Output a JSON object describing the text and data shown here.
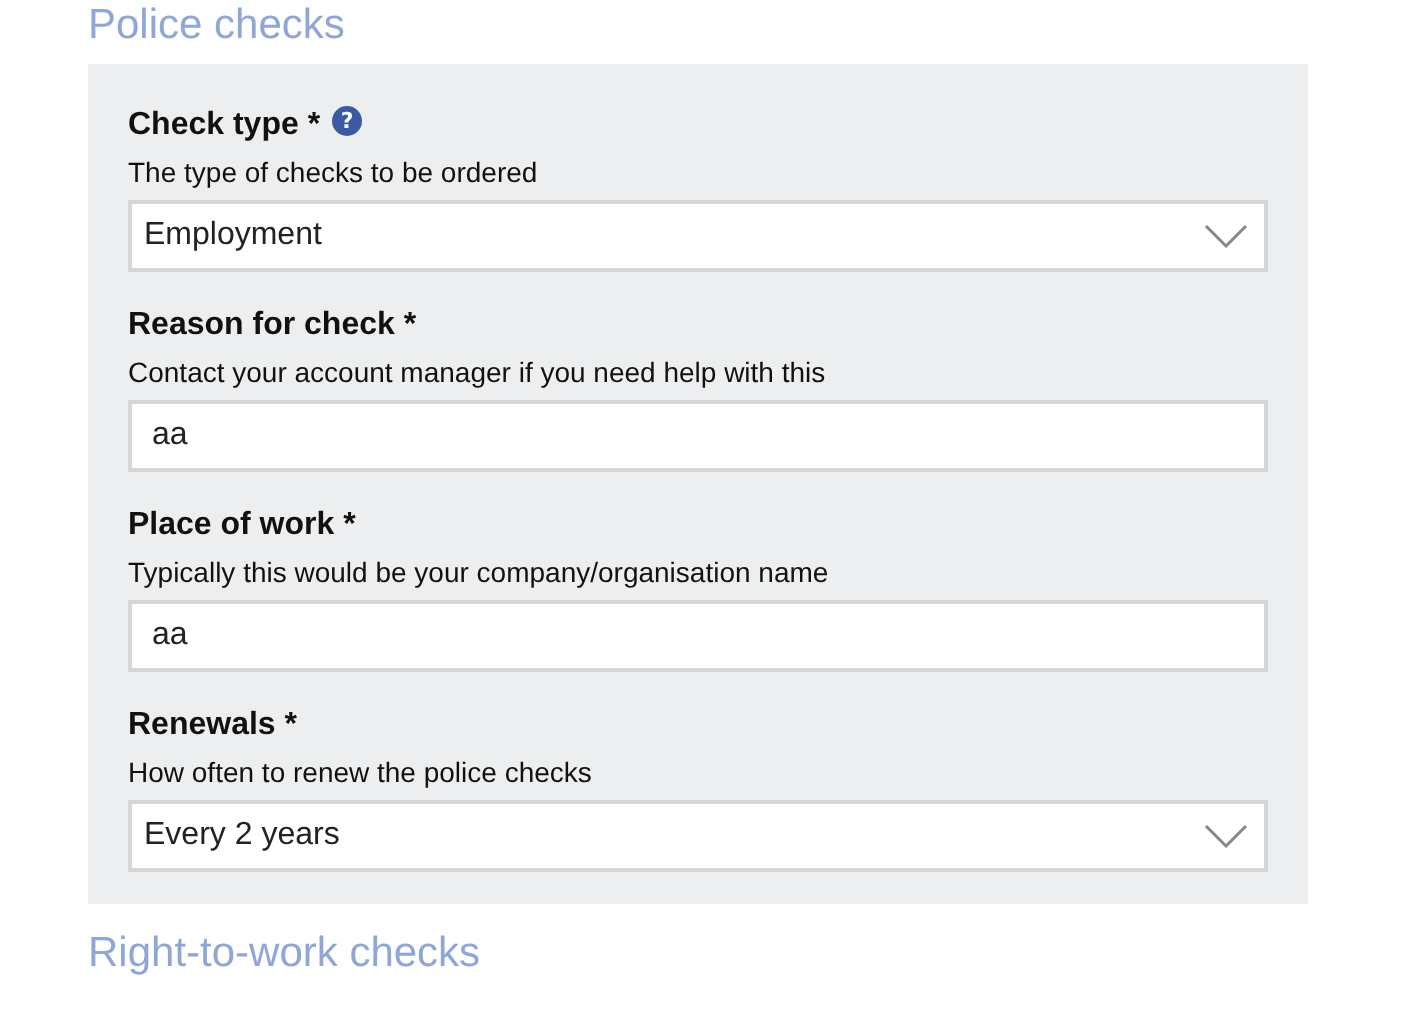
{
  "sections": [
    {
      "title": "Police checks",
      "fields": [
        {
          "kind": "select",
          "label": "Check type",
          "required_mark": "*",
          "help": "?",
          "hint": "The type of checks to be ordered",
          "value": "Employment"
        },
        {
          "kind": "text",
          "label": "Reason for check",
          "required_mark": "*",
          "hint": "Contact your account manager if you need help with this",
          "value": "aa"
        },
        {
          "kind": "text",
          "label": "Place of work",
          "required_mark": "*",
          "hint": "Typically this would be your company/organisation name",
          "value": "aa"
        },
        {
          "kind": "select",
          "label": "Renewals",
          "required_mark": "*",
          "hint": "How often to renew the police checks",
          "value": "Every 2 years"
        }
      ]
    },
    {
      "title": "Right-to-work checks"
    }
  ]
}
